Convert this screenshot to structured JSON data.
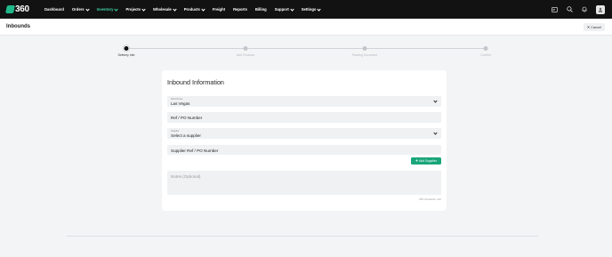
{
  "app": {
    "logo_text": "360"
  },
  "nav": {
    "items": [
      {
        "label": "Dashboard",
        "dropdown": false,
        "active": false
      },
      {
        "label": "Orders",
        "dropdown": true,
        "active": false
      },
      {
        "label": "Inventory",
        "dropdown": true,
        "active": true
      },
      {
        "label": "Projects",
        "dropdown": true,
        "active": false
      },
      {
        "label": "Wholesale",
        "dropdown": true,
        "active": false
      },
      {
        "label": "Products",
        "dropdown": true,
        "active": false
      },
      {
        "label": "Freight",
        "dropdown": false,
        "active": false
      },
      {
        "label": "Reports",
        "dropdown": false,
        "active": false
      },
      {
        "label": "Billing",
        "dropdown": false,
        "active": false
      },
      {
        "label": "Support",
        "dropdown": true,
        "active": false
      },
      {
        "label": "Settings",
        "dropdown": true,
        "active": false
      }
    ],
    "right_icons": [
      "id-card-icon",
      "search-icon",
      "bell-icon",
      "user-avatar-icon"
    ]
  },
  "header": {
    "title": "Inbounds",
    "cancel_label": "Cancel"
  },
  "stepper": {
    "steps": [
      {
        "label": "Delivery Info",
        "active": true
      },
      {
        "label": "Add Products",
        "active": false
      },
      {
        "label": "Packing Document",
        "active": false
      },
      {
        "label": "Confirm",
        "active": false
      }
    ]
  },
  "form": {
    "title": "Inbound Information",
    "warehouse": {
      "label": "Warehouse",
      "value": "Las Vegas"
    },
    "ref": {
      "placeholder": "Ref / PO Number"
    },
    "supplier": {
      "label": "Supplier",
      "value": "Select a supplier"
    },
    "supplier_ref": {
      "placeholder": "Supplier Ref / PO Number"
    },
    "add_supplier_label": "Add Supplier",
    "notes": {
      "placeholder": "Notes (Optional)"
    },
    "char_limit": "250 character max"
  },
  "colors": {
    "nav_bg": "#121212",
    "accent": "#1aa57a",
    "active_nav": "#3fd1a5"
  }
}
